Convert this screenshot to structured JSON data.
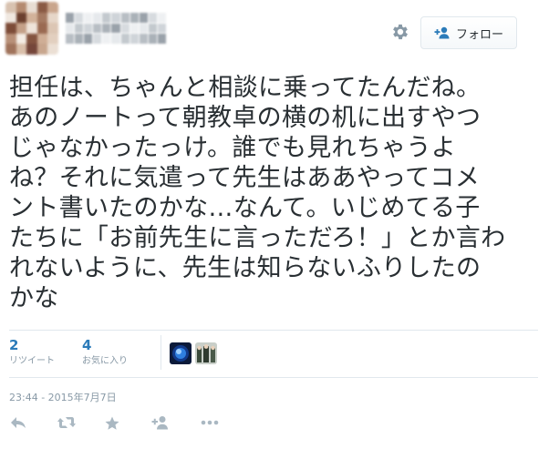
{
  "header": {
    "follow_label": "フォロー"
  },
  "tweet": {
    "lines": [
      "担任は、ちゃんと相談に乗ってたんだね。",
      "あのノートって朝教卓の横の机に出すやつ",
      "じゃなかったっけ。誰でも見れちゃうよ",
      "ね？それに気遣って先生はああやってコメ",
      "ント書いたのかな…なんて。いじめてる子",
      "たちに「お前先生に言っただろ！」とか言わ",
      "れないように、先生は知らないふりしたの",
      "かな"
    ]
  },
  "stats": {
    "retweets": {
      "count": "2",
      "label": "リツイート"
    },
    "favorites": {
      "count": "4",
      "label": "お気に入り"
    }
  },
  "timestamp": "23:44 - 2015年7月7日",
  "colors": {
    "link_blue": "#2b7bb9",
    "muted_gray": "#8899a6",
    "icon_gray": "#aab8c2",
    "divider": "#e1e8ed",
    "text": "#292f33"
  },
  "icons": {
    "settings": "gear-icon",
    "follow": "person-plus-icon",
    "actions": [
      "reply-icon",
      "retweet-icon",
      "favorite-star-icon",
      "follow-person-icon",
      "more-ellipsis-icon"
    ]
  }
}
